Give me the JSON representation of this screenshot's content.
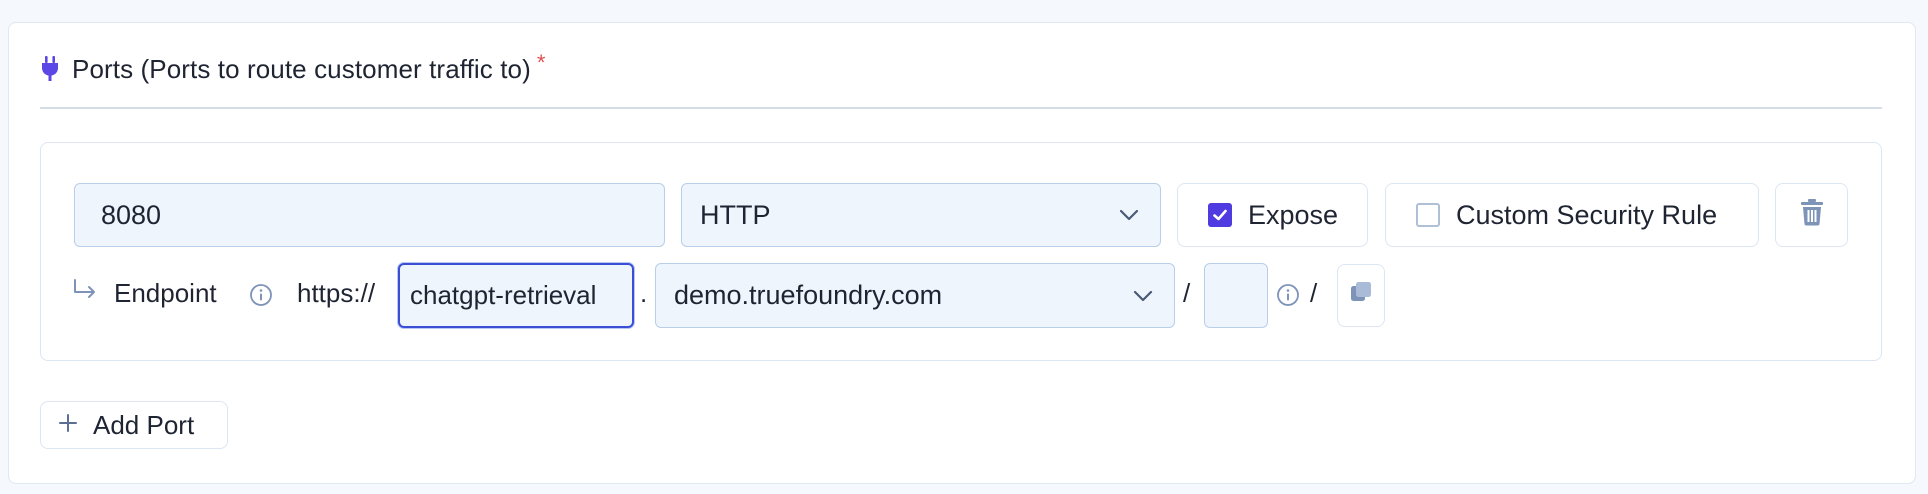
{
  "section": {
    "title": "Ports (Ports to route customer traffic to)",
    "required_mark": "*",
    "icon": "plug-icon"
  },
  "port": {
    "number": "8080",
    "protocol": "HTTP",
    "expose_label": "Expose",
    "expose_checked": true,
    "security_label": "Custom Security Rule",
    "security_checked": false
  },
  "endpoint": {
    "label": "Endpoint",
    "scheme": "https://",
    "subdomain": "chatgpt-retrieval",
    "separator": ".",
    "domain": "demo.truefoundry.com",
    "slash": "/",
    "path": "",
    "trailing_slash": "/"
  },
  "actions": {
    "add_port_label": "Add Port"
  },
  "colors": {
    "accent": "#4f3be0",
    "focus_border": "#3a4fd6",
    "input_bg": "#eef5fd",
    "required": "#e05252"
  }
}
